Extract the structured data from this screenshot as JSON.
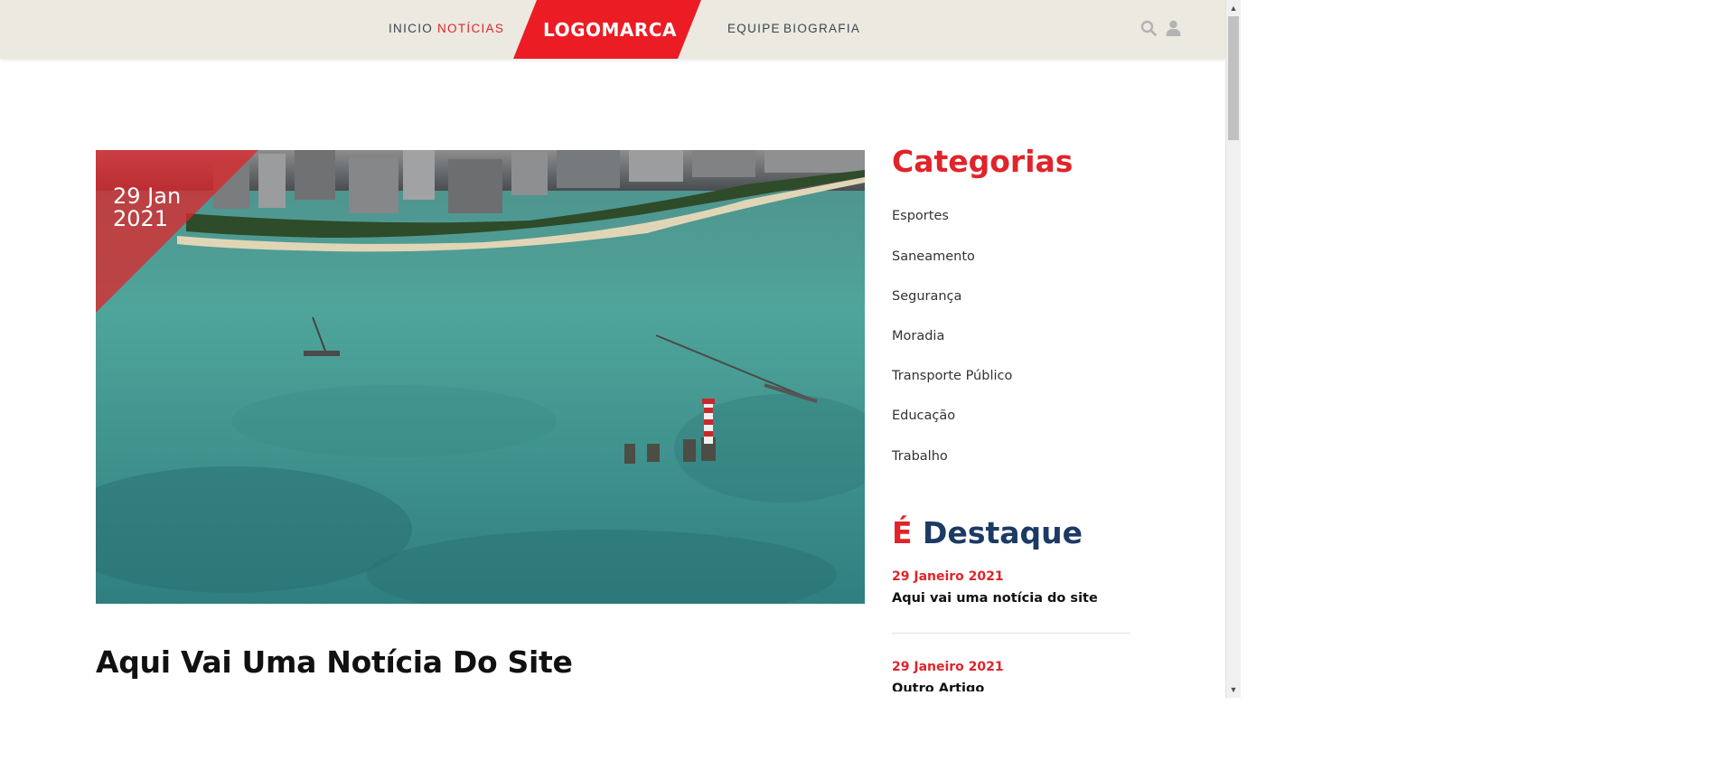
{
  "header": {
    "nav_left": [
      {
        "label": "INICIO",
        "active": false
      },
      {
        "label": "NOTÍCIAS",
        "active": true
      }
    ],
    "logo_text": "LOGOMARCA",
    "nav_right": [
      {
        "label": "EQUIPE",
        "active": false
      },
      {
        "label": "BIOGRAFIA",
        "active": false
      }
    ],
    "icons": [
      "search-icon",
      "user-icon"
    ]
  },
  "article": {
    "date_day_month": "29 Jan",
    "date_year": "2021",
    "title": "Aqui Vai Uma Notícia Do Site"
  },
  "sidebar": {
    "categories_title": "Categorias",
    "categories": [
      "Esportes",
      "Saneamento",
      "Segurança",
      "Moradia",
      "Transporte Público",
      "Educação",
      "Trabalho"
    ],
    "featured_accent": "É",
    "featured_title": "Destaque",
    "featured_posts": [
      {
        "date": "29 Janeiro 2021",
        "title": "Aqui vai uma notícia do site"
      },
      {
        "date": "29 Janeiro 2021",
        "title": "Outro Artigo"
      }
    ]
  },
  "colors": {
    "brand_red": "#e0242a",
    "navy": "#1c3a63",
    "header_bg": "#ebe9e0"
  }
}
